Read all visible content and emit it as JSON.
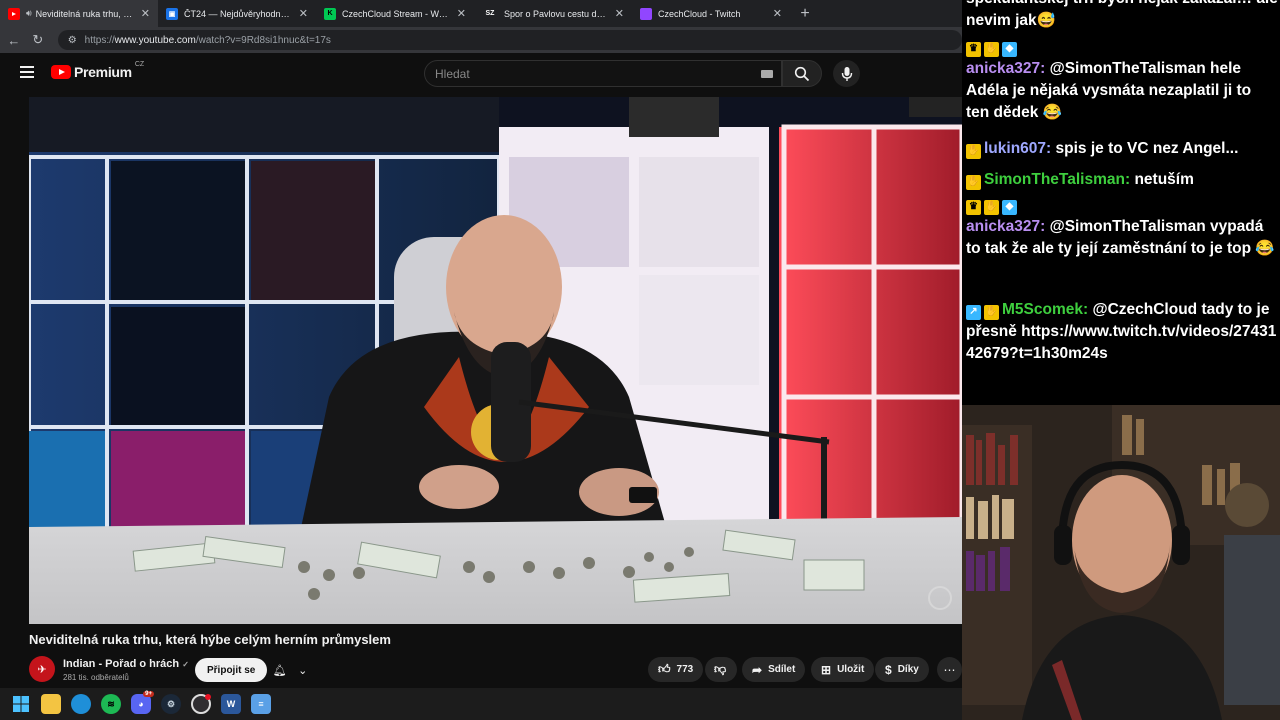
{
  "tabs": [
    {
      "title": "Neviditelná ruka trhu, která hý…",
      "favicon_color": "#ff0000",
      "active": true
    },
    {
      "title": "ČT24 — Nejdůvěryhodnější zprav…",
      "favicon_color": "#1a73e8",
      "active": false
    },
    {
      "title": "CzechCloud Stream - Watch Live o…",
      "favicon_color": "#00c853",
      "active": false
    },
    {
      "title": "Spor o Pavlovu cestu do NATO: „Ja…",
      "favicon_color": "#ffffff",
      "favicon_text": "SZ",
      "active": false
    },
    {
      "title": "CzechCloud - Twitch",
      "favicon_color": "#9146ff",
      "active": false
    }
  ],
  "address": {
    "prefix": "https://",
    "host": "www.youtube.com",
    "path": "/watch?v=9Rd8si1hnuc&t=17s"
  },
  "youtube": {
    "logo_word": "Premium",
    "logo_region": "CZ",
    "search_placeholder": "Hledat",
    "video_title": "Neviditelná ruka trhu, která hýbe celým herním průmyslem",
    "channel_name": "Indian - Pořad o hrách",
    "channel_verified": "✓",
    "subscribers": "281 tis. odběratelů",
    "join_label": "Připojit se",
    "like_count": "773",
    "share_label": "Sdílet",
    "save_label": "Uložit",
    "thanks_label": "Díky"
  },
  "taskbar": {
    "icons": [
      "windows-start-icon",
      "file-explorer-icon",
      "edge-icon",
      "spotify-icon",
      "discord-icon",
      "steam-icon",
      "obs-icon",
      "word-icon",
      "notepad-icon"
    ],
    "discord_badge": "9+"
  },
  "chat": {
    "messages": [
      {
        "user": "",
        "user_color": "#ffffff",
        "text": "spekulantskej trh bych nějak zakázal… ale nevim jak😅",
        "badges": []
      },
      {
        "user": "anicka327:",
        "user_color": "#b98ef0",
        "text": "@SimonTheTalisman hele Adéla je nějaká vysmáta nezaplatil ji to ten dědek 😂",
        "badges": [
          "crown-badge",
          "hand-badge",
          "cube-badge"
        ]
      },
      {
        "user": "lukin607:",
        "user_color": "#9fa8ff",
        "text": "spis je to VC nez Angel...",
        "badges": [
          "hand-badge"
        ]
      },
      {
        "user": "SimonTheTalisman:",
        "user_color": "#3ecf3e",
        "text": "netuším",
        "badges": [
          "hand-badge"
        ]
      },
      {
        "user": "anicka327:",
        "user_color": "#b98ef0",
        "text": "@SimonTheTalisman vypadá to tak že ale ty její zaměstnání to je top 😂",
        "badges": [
          "crown-badge",
          "hand-badge",
          "cube-badge"
        ]
      },
      {
        "user": "M5Scomek:",
        "user_color": "#3ecf3e",
        "text": "@CzechCloud tady to je přesně https://www.twitch.tv/videos/2743142679?t=1h30m24s",
        "badges": [
          "arrow-badge",
          "hand-badge"
        ]
      }
    ]
  }
}
